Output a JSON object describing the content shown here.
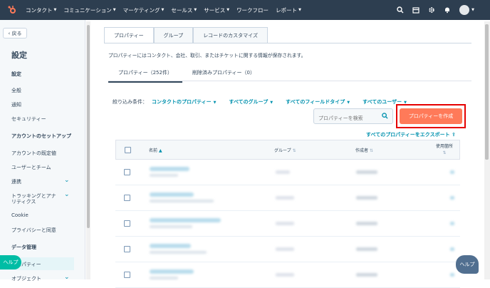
{
  "nav": {
    "items": [
      "コンタクト",
      "コミュニケーション",
      "マーケティング",
      "セールス",
      "サービス",
      "ワークフロー",
      "レポート"
    ],
    "has_chevron": [
      true,
      true,
      true,
      true,
      true,
      false,
      true
    ]
  },
  "sidebar": {
    "back_label": "戻る",
    "title": "設定",
    "section1": "設定",
    "items1": [
      "全般",
      "通知",
      "セキュリティー"
    ],
    "section2": "アカウントのセットアップ",
    "items2": [
      "アカウントの既定値",
      "ユーザーとチーム",
      "連携",
      "トラッキングとアナ",
      "リティクス",
      "Cookie",
      "プライバシーと同意"
    ],
    "section3": "データ管理",
    "items3": [
      "プロパティー",
      "オブジェクト"
    ],
    "help_label": "ヘルプ"
  },
  "main": {
    "tabs": [
      "プロパティー",
      "グループ",
      "レコードのカスタマイズ"
    ],
    "description": "プロパティーにはコンタクト、会社、取引、またはチケットに関する情報が保存されます。",
    "subtabs": [
      "プロパティー（252件）",
      "削除済みプロパティー（0）"
    ],
    "filter_label": "絞り込み条件：",
    "filters": [
      "コンタクトのプロパティー",
      "すべてのグループ",
      "すべてのフィールドタイプ",
      "すべてのユーザー"
    ],
    "search_placeholder": "プロパティーを検索",
    "create_button": "プロパティーを作成",
    "export_link": "すべてのプロパティーをエクスポート",
    "columns": [
      "名前",
      "グループ",
      "作成者",
      "使用箇所"
    ],
    "help_label": "ヘルプ"
  }
}
